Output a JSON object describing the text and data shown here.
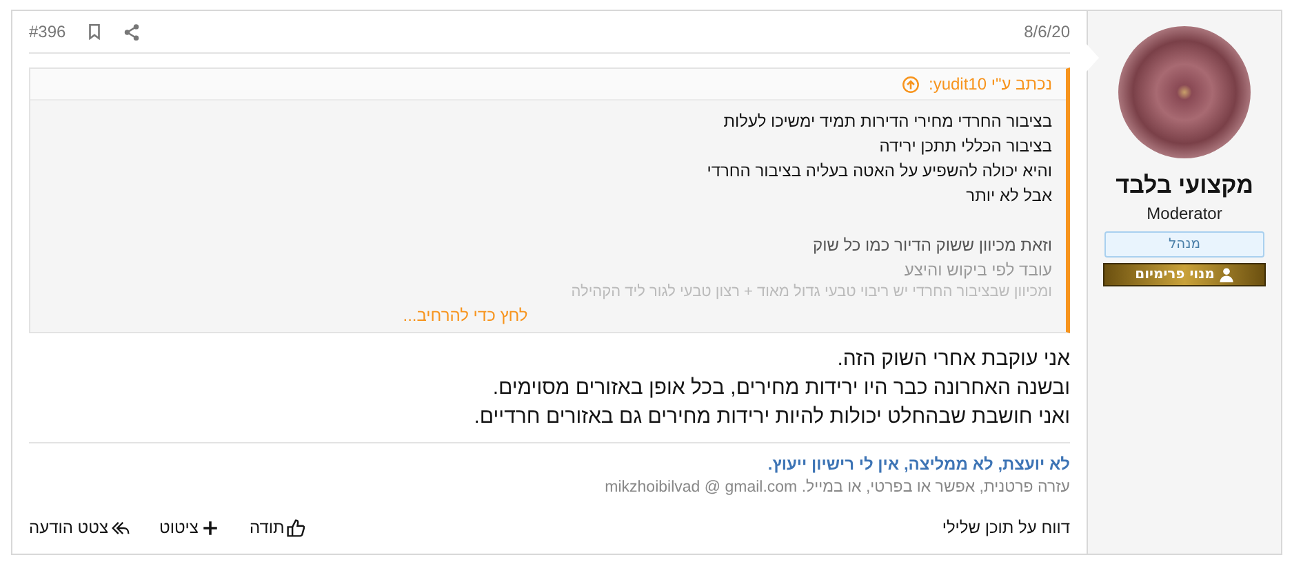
{
  "user": {
    "name": "מקצועי בלבד",
    "title": "Moderator",
    "badges": [
      {
        "kind": "role",
        "label": "מנהל"
      },
      {
        "kind": "premium",
        "label": "מנוי פרימיום"
      }
    ]
  },
  "post": {
    "date": "8/6/20",
    "number": "#396",
    "quote": {
      "author": "נכתב ע\"י yudit10:",
      "lines": [
        {
          "text": "בציבור החרדי מחירי הדירות תמיד ימשיכו לעלות",
          "kind": "normal"
        },
        {
          "text": "בציבור הכללי תתכן ירידה",
          "kind": "normal"
        },
        {
          "text": "והיא יכולה להשפיע על האטה בעליה בציבור החרדי",
          "kind": "normal"
        },
        {
          "text": "אבל לא יותר",
          "kind": "normal"
        },
        {
          "text": "וזאת מכיוון ששוק הדיור כמו כל שוק",
          "kind": "fading",
          "gap_before": true
        },
        {
          "text": "עובד לפי ביקוש והיצע",
          "kind": "faded"
        },
        {
          "text": "ומכיוון שבציבור החרדי יש ריבוי טבעי גדול מאוד + רצון טבעי לגור ליד הקהילה",
          "kind": "faint"
        }
      ],
      "expand": "לחץ כדי להרחיב..."
    },
    "body": [
      "אני עוקבת אחרי השוק הזה.",
      "ובשנה האחרונה כבר היו ירידות מחירים, בכל אופן באזורים מסוימים.",
      "ואני חושבת שבהחלט יכולות להיות ירידות מחירים גם באזורים חרדיים."
    ],
    "signature": [
      "לא יועצת, לא ממליצה, אין לי רישיון ייעוץ.",
      "עזרה פרטנית, אפשר או בפרטי, או במייל. mikzhoibilvad @ gmail.com"
    ],
    "report": "דווח על תוכן שלילי",
    "actions": [
      {
        "kind": "like",
        "label": "תודה"
      },
      {
        "kind": "quote",
        "label": "ציטוט"
      },
      {
        "kind": "reply",
        "label": "צטט הודעה"
      }
    ]
  }
}
